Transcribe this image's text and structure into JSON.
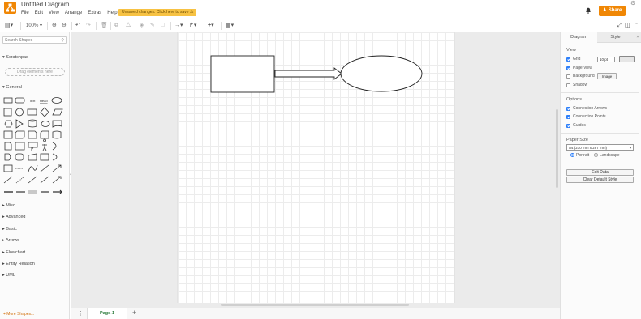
{
  "header": {
    "title": "Untitled Diagram",
    "menu": [
      "File",
      "Edit",
      "View",
      "Arrange",
      "Extras",
      "Help"
    ],
    "unsaved_notice": "Unsaved changes. Click here to save",
    "share_label": "Share"
  },
  "toolbar": {
    "zoom": "100%"
  },
  "sidebar": {
    "search_placeholder": "Search Shapes",
    "scratchpad_label": "Scratchpad",
    "scratchpad_drop_hint": "Drag elements here",
    "general_label": "General",
    "categories": [
      "Misc",
      "Advanced",
      "Basic",
      "Arrows",
      "Flowchart",
      "Entity Relation",
      "UML"
    ],
    "more_shapes_label": "+ More Shapes..."
  },
  "pages": {
    "tabs": [
      "Page-1"
    ]
  },
  "right_panel": {
    "tabs": [
      "Diagram",
      "Style"
    ],
    "view_heading": "View",
    "grid_label": "Grid",
    "grid_size": "10 pt",
    "page_view_label": "Page View",
    "background_label": "Background",
    "image_button_label": "Image",
    "shadow_label": "Shadow",
    "options_heading": "Options",
    "connection_arrows_label": "Connection Arrows",
    "connection_points_label": "Connection Points",
    "guides_label": "Guides",
    "paper_size_heading": "Paper Size",
    "paper_size_value": "A4 (210 mm x 297 mm)",
    "portrait_label": "Portrait",
    "landscape_label": "Landscape",
    "edit_data_label": "Edit Data",
    "clear_default_style_label": "Clear Default Style"
  },
  "checkbox_state": {
    "grid": true,
    "page_view": true,
    "background": false,
    "shadow": false,
    "connection_arrows": true,
    "connection_points": true,
    "guides": true
  },
  "colors": {
    "brand_orange": "#f08705",
    "unsaved_yellow": "#f7c243",
    "page_tab_green": "#2b7a3a",
    "check_blue": "#2d7ff9"
  }
}
